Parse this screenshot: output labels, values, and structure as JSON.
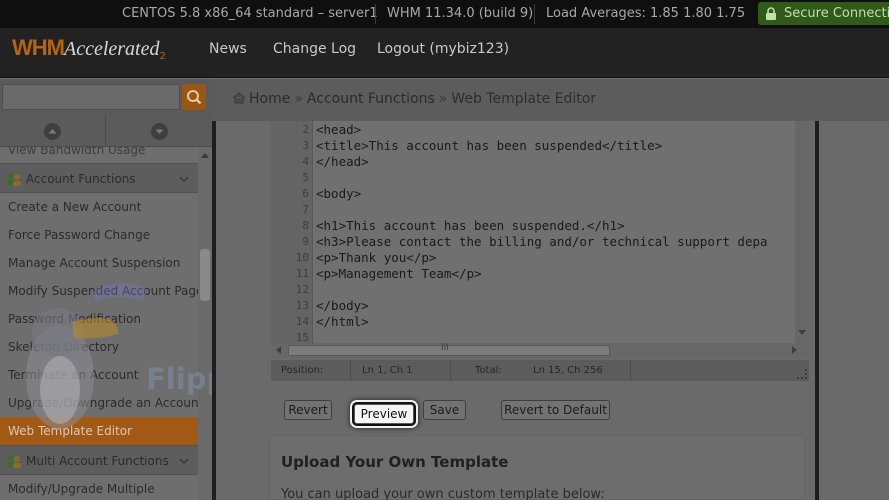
{
  "statusbar": {
    "os": "CENTOS 5.8 x86_64 standard – server1",
    "whm": "WHM 11.34.0 (build 9)",
    "load": "Load Averages: 1.85 1.80 1.75",
    "secure": "Secure Connecti"
  },
  "header": {
    "logo_whm": "WHM",
    "logo_accelerated": "Accelerated",
    "logo_version": "2",
    "nav": [
      "News",
      "Change Log",
      "Logout (mybiz123)"
    ]
  },
  "search": {
    "value": "",
    "placeholder": ""
  },
  "breadcrumb": {
    "home": "Home",
    "section": "Account Functions",
    "current": "Web Template Editor",
    "separator": "»"
  },
  "sidebar": {
    "cut_item": "View Bandwidth Usage",
    "group1": "Account Functions",
    "items": [
      "Create a New Account",
      "Force Password Change",
      "Manage Account Suspension",
      "Modify Suspended Account Page",
      "Password Modification",
      "Skeleton Directory",
      "Terminate an Account",
      "Upgrade/Downgrade an Account",
      "Web Template Editor"
    ],
    "active_item": "Web Template Editor",
    "group2": "Multi Account Functions",
    "group2_item": "Modify/Upgrade Multiple"
  },
  "watermark": "FlipperHost",
  "editor": {
    "lines": [
      {
        "n": "2",
        "code": "<head>"
      },
      {
        "n": "3",
        "code": "<title>This account has been suspended</title>"
      },
      {
        "n": "4",
        "code": "</head>"
      },
      {
        "n": "5",
        "code": ""
      },
      {
        "n": "6",
        "code": "<body>"
      },
      {
        "n": "7",
        "code": ""
      },
      {
        "n": "8",
        "code": "<h1>This account has been suspended.</h1>"
      },
      {
        "n": "9",
        "code": "<h3>Please contact the billing and/or technical support depa"
      },
      {
        "n": "10",
        "code": "<p>Thank you</p>"
      },
      {
        "n": "11",
        "code": "<p>Management Team</p>"
      },
      {
        "n": "12",
        "code": ""
      },
      {
        "n": "13",
        "code": "</body>"
      },
      {
        "n": "14",
        "code": "</html>"
      },
      {
        "n": "15",
        "code": ""
      }
    ],
    "position_label": "Position:",
    "position_value": "Ln 1, Ch 1",
    "total_label": "Total:",
    "total_value": "Ln 15, Ch 256",
    "hscroll_grip": "III"
  },
  "buttons": {
    "revert": "Revert",
    "preview": "Preview",
    "save": "Save",
    "revert_default": "Revert to Default"
  },
  "upload": {
    "title": "Upload Your Own Template",
    "text": "You can upload your own custom template below:"
  },
  "colors": {
    "accent": "#a25915",
    "secure": "#2f5a1c",
    "header": "#222222"
  }
}
